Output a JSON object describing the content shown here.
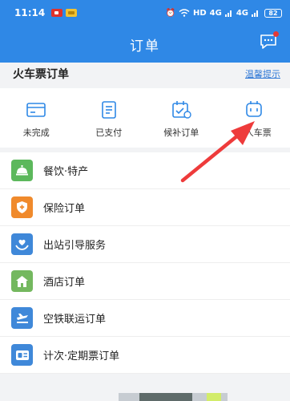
{
  "statusbar": {
    "time": "11:14",
    "net": "HD",
    "signal1": "4G",
    "signal2": "4G",
    "battery": "82"
  },
  "header": {
    "title": "订单"
  },
  "section": {
    "title": "火车票订单",
    "hint_link": "温馨提示"
  },
  "order_status": [
    {
      "label": "未完成",
      "icon": "card-icon"
    },
    {
      "label": "已支付",
      "icon": "receipt-icon"
    },
    {
      "label": "候补订单",
      "icon": "calendar-check-icon"
    },
    {
      "label": "本人车票",
      "icon": "train-ticket-icon"
    }
  ],
  "services": [
    {
      "label": "餐饮·特产",
      "icon": "food-bell-icon",
      "color": "#5cb85c"
    },
    {
      "label": "保险订单",
      "icon": "shield-icon",
      "color": "#f08a2c"
    },
    {
      "label": "出站引导服务",
      "icon": "heart-hands-icon",
      "color": "#3f88d9"
    },
    {
      "label": "酒店订单",
      "icon": "hotel-icon",
      "color": "#74b85f"
    },
    {
      "label": "空铁联运订单",
      "icon": "plane-train-icon",
      "color": "#3f88d9"
    },
    {
      "label": "计次·定期票订单",
      "icon": "pass-card-icon",
      "color": "#3f88d9"
    }
  ],
  "colors": {
    "header": "#2f88e6",
    "link": "#2f78d6",
    "arrow": "#ee3b3b"
  }
}
